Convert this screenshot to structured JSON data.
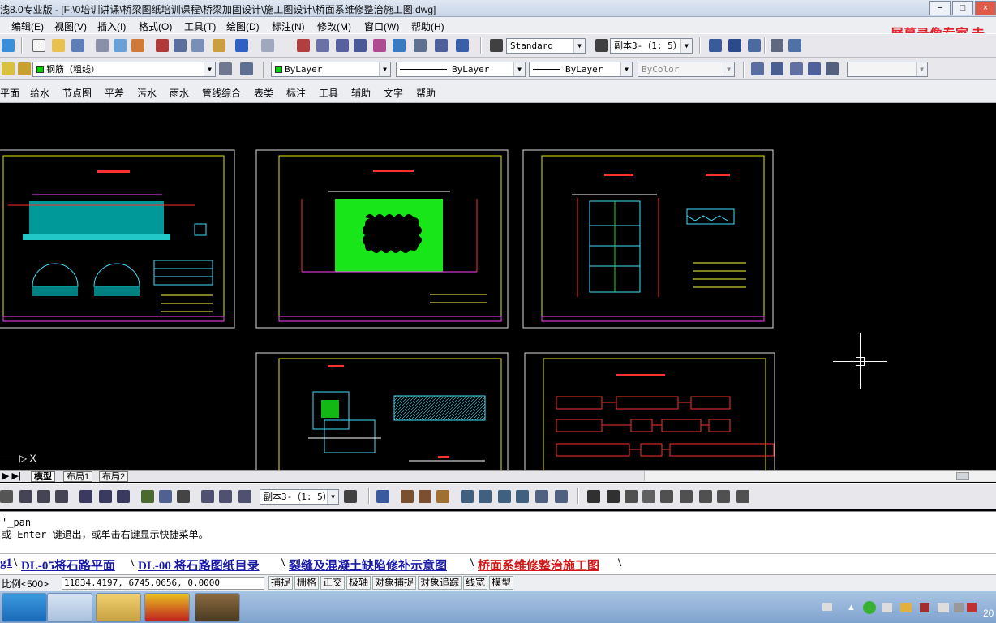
{
  "window": {
    "title": "浅8.0专业版 - [F:\\0培训讲课\\桥梁图纸培训课程\\桥梁加固设计\\施工图设计\\桥面系维修整治施工图.dwg]",
    "controls": [
      "−",
      "□",
      "×"
    ]
  },
  "watermark": "屏幕录像专家 未",
  "menubar": [
    "编辑(E)",
    "视图(V)",
    "插入(I)",
    "格式(O)",
    "工具(T)",
    "绘图(D)",
    "标注(N)",
    "修改(M)",
    "窗口(W)",
    "帮助(H)"
  ],
  "toolbar1": {
    "text_style": "Standard",
    "dim_style": "副本3-（1: 5）"
  },
  "toolbar2": {
    "layer": "钢筋（粗线）",
    "color": "ByLayer",
    "linetype": "ByLayer",
    "lineweight": "ByLayer",
    "plotstyle": "ByColor",
    "colors": {
      "layer_swatch": "#00d400",
      "color_swatch": "#00d400"
    }
  },
  "custom_menu": [
    "平面",
    "给水",
    "节点图",
    "平差",
    "污水",
    "雨水",
    "管线综合",
    "表类",
    "标注",
    "工具",
    "辅助",
    "文字",
    "帮助"
  ],
  "canvas": {
    "ucs_label": "X",
    "background": "#000000"
  },
  "layout_tabs": [
    "模型",
    "布局1",
    "布局2"
  ],
  "toolbar3": {
    "dim_style": "副本3-（1: 5）"
  },
  "command": {
    "lines": [
      "'_pan",
      "或 Enter 键退出，或单击右键显示快捷菜单。"
    ]
  },
  "file_tabs": [
    "g1",
    "DL-05将石路平面",
    "DL-00 将石路图纸目录",
    "裂缝及混凝土缺陷修补示意图",
    "桥面系维修整治施工图"
  ],
  "status": {
    "scale_label": "比例<500>",
    "coords": "11834.4197, 6745.0656, 0.0000",
    "toggles": [
      "捕捉",
      "栅格",
      "正交",
      "极轴",
      "对象捕捉",
      "对象追踪",
      "线宽",
      "模型"
    ]
  },
  "taskbar": {
    "clock": "20"
  }
}
